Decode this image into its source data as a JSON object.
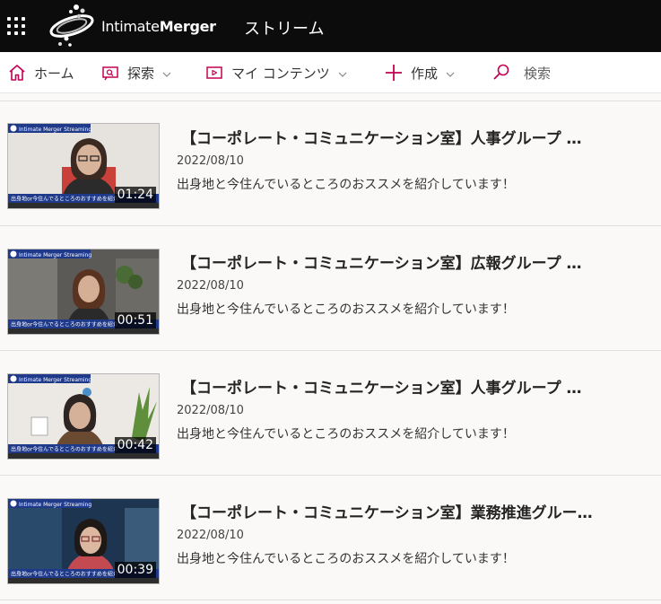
{
  "header": {
    "brand_part1": "Intimate",
    "brand_part2": "Merger",
    "app_title": "ストリーム"
  },
  "nav": {
    "home": "ホーム",
    "explore": "探索",
    "my_content": "マイ コンテンツ",
    "create": "作成",
    "search": "検索"
  },
  "thumbnail": {
    "banner": "Intimate Merger Streaming",
    "caption": "出身地or今住んでるところのおすすめを紹介"
  },
  "videos": [
    {
      "title": "【コーポレート・コミュニケーション室】人事グループ …",
      "date": "2022/08/10",
      "description": "出身地と今住んでいるところのおススメを紹介しています！",
      "duration": "01:24"
    },
    {
      "title": "【コーポレート・コミュニケーション室】広報グループ …",
      "date": "2022/08/10",
      "description": "出身地と今住んでいるところのおススメを紹介しています！",
      "duration": "00:51"
    },
    {
      "title": "【コーポレート・コミュニケーション室】人事グループ …",
      "date": "2022/08/10",
      "description": "出身地と今住んでいるところのおススメを紹介しています！",
      "duration": "00:42"
    },
    {
      "title": "【コーポレート・コミュニケーション室】業務推進グルー…",
      "date": "2022/08/10",
      "description": "出身地と今住んでいるところのおススメを紹介しています！",
      "duration": "00:39"
    }
  ],
  "colors": {
    "accent": "#c30052",
    "topbar": "#0c0c0c",
    "banner": "#1f3a8a"
  },
  "icons": [
    "app-launcher-icon",
    "home-icon",
    "explore-icon",
    "video-icon",
    "plus-icon",
    "search-icon",
    "chevron-down-icon"
  ]
}
